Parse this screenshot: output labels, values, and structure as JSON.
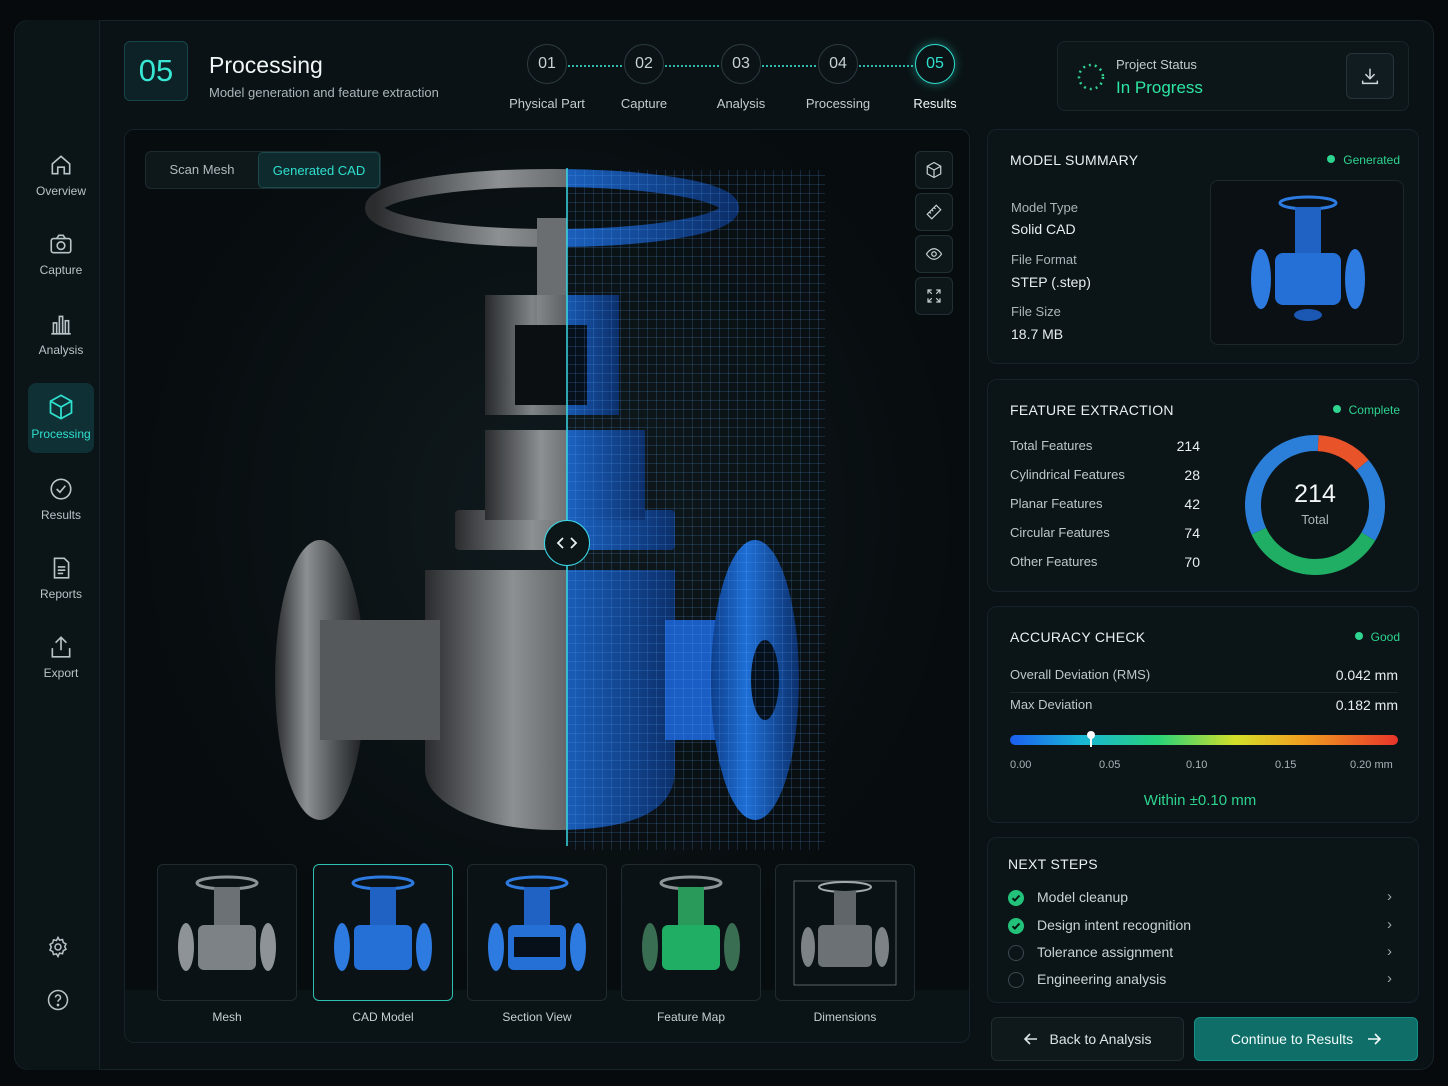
{
  "sidebar": {
    "items": [
      {
        "label": "Overview",
        "icon": "home-icon"
      },
      {
        "label": "Capture",
        "icon": "camera-icon"
      },
      {
        "label": "Analysis",
        "icon": "bar-chart-icon"
      },
      {
        "label": "Processing",
        "icon": "cube-icon"
      },
      {
        "label": "Results",
        "icon": "check-circle-icon"
      },
      {
        "label": "Reports",
        "icon": "document-icon"
      },
      {
        "label": "Export",
        "icon": "export-icon"
      }
    ],
    "active": "Processing"
  },
  "header": {
    "step_number": "05",
    "title": "Processing",
    "subtitle": "Model generation and feature extraction"
  },
  "stepper": [
    {
      "num": "01",
      "label": "Physical Part"
    },
    {
      "num": "02",
      "label": "Capture"
    },
    {
      "num": "03",
      "label": "Analysis"
    },
    {
      "num": "04",
      "label": "Processing"
    },
    {
      "num": "05",
      "label": "Results"
    }
  ],
  "project_status": {
    "label": "Project Status",
    "value": "In Progress"
  },
  "viewer": {
    "toggle": [
      "Scan Mesh",
      "Generated CAD"
    ],
    "thumbnails": [
      "Mesh",
      "CAD Model",
      "Section View",
      "Feature Map",
      "Dimensions"
    ]
  },
  "model_summary": {
    "title": "MODEL SUMMARY",
    "badge": "Generated",
    "model_type_label": "Model Type",
    "model_type": "Solid CAD",
    "file_format_label": "File Format",
    "file_format": "STEP (.step)",
    "file_size_label": "File Size",
    "file_size": "18.7 MB"
  },
  "feature_extraction": {
    "title": "FEATURE EXTRACTION",
    "badge": "Complete",
    "rows": [
      {
        "label": "Total Features",
        "value": "214"
      },
      {
        "label": "Cylindrical Features",
        "value": "28"
      },
      {
        "label": "Planar Features",
        "value": "42"
      },
      {
        "label": "Circular Features",
        "value": "74"
      },
      {
        "label": "Other Features",
        "value": "70"
      }
    ],
    "donut_total": "214",
    "donut_label": "Total"
  },
  "chart_data": {
    "type": "pie",
    "categories": [
      "Cylindrical Features",
      "Planar Features",
      "Circular Features",
      "Other Features"
    ],
    "values": [
      28,
      42,
      74,
      70
    ],
    "colors": [
      "#e8532a",
      "#2c7fd8",
      "#1fae63",
      "#2c7fd8"
    ]
  },
  "accuracy": {
    "title": "ACCURACY CHECK",
    "badge": "Good",
    "rms_label": "Overall Deviation (RMS)",
    "rms_value": "0.042 mm",
    "max_label": "Max Deviation",
    "max_value": "0.182 mm",
    "scale_ticks": [
      "0.00",
      "0.05",
      "0.10",
      "0.15",
      "0.20 mm"
    ],
    "scale_min": 0,
    "scale_max": 0.2,
    "marker_value": 0.042,
    "within": "Within ±0.10 mm"
  },
  "next_steps": {
    "title": "NEXT STEPS",
    "items": [
      {
        "label": "Model cleanup",
        "done": true
      },
      {
        "label": "Design intent recognition",
        "done": true
      },
      {
        "label": "Tolerance assignment",
        "done": false
      },
      {
        "label": "Engineering analysis",
        "done": false
      }
    ]
  },
  "buttons": {
    "back": "Back to Analysis",
    "next": "Continue to Results"
  },
  "colors": {
    "accent": "#2fe0cf",
    "success": "#2ed48f",
    "primary_button": "#0f6e68"
  }
}
